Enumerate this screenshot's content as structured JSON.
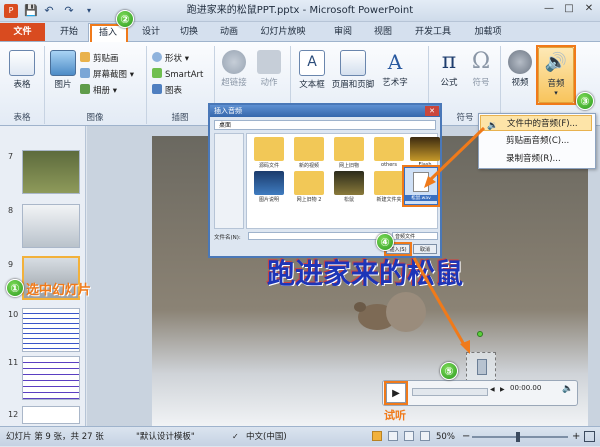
{
  "window": {
    "title": "跑进家来的松鼠PPT.pptx - Microsoft PowerPoint",
    "controls": [
      "—",
      "□",
      "✕"
    ]
  },
  "tabs": [
    "文件",
    "开始",
    "插入",
    "设计",
    "切换",
    "动画",
    "幻灯片放映",
    "审阅",
    "视图",
    "开发工具",
    "加载项"
  ],
  "ribbon": {
    "table": "表格",
    "image": "图片",
    "clipart": "剪贴画",
    "screenshot": "屏幕截图",
    "album": "相册",
    "shapes": "形状",
    "smartart": "SmartArt",
    "chart": "图表",
    "hyperlink": "超链接",
    "action": "动作",
    "textbox": "文本框",
    "header_footer": "页眉和页脚",
    "wordart": "艺术字",
    "equation": "公式",
    "symbol": "符号",
    "video": "视频",
    "audio": "音频",
    "groups": {
      "tables": "表格",
      "images": "图像",
      "illustrations": "插图",
      "symbols": "符号"
    }
  },
  "audio_menu": [
    "文件中的音频(F)...",
    "剪贴画音频(C)...",
    "录制音频(R)..."
  ],
  "dialog": {
    "title": "插入音频",
    "path": "桌面",
    "files": [
      "源码文件",
      "新的视频",
      "网上旧物",
      "others",
      "Flash",
      "图片说明",
      "网上旧物 2",
      "松鼠",
      "新建文件夹",
      "松鼠.wav"
    ],
    "filename_label": "文件名(N):",
    "filetype_label": "音频文件",
    "insert_button": "插入(S)",
    "cancel_button": "取消"
  },
  "thumbnails": [
    "7",
    "8",
    "9",
    "10",
    "11",
    "12"
  ],
  "callouts": {
    "one": "①",
    "two": "②",
    "three": "③",
    "four": "④",
    "five": "⑤",
    "select_slide": "选中幻灯片",
    "audition": "试听"
  },
  "slide_title": "跑进家来的松鼠",
  "player": {
    "time": "00:00.00"
  },
  "status": {
    "slide_info": "幻灯片 第 9 张，共 27 张",
    "theme": "\"默认设计模板\"",
    "language": "中文(中国)",
    "zoom": "50%"
  },
  "colors": {
    "file_tab": "#d94b1f",
    "highlight": "#f07a1a",
    "badge": "#2a9a1f",
    "callout_text": "#f07a1a"
  }
}
